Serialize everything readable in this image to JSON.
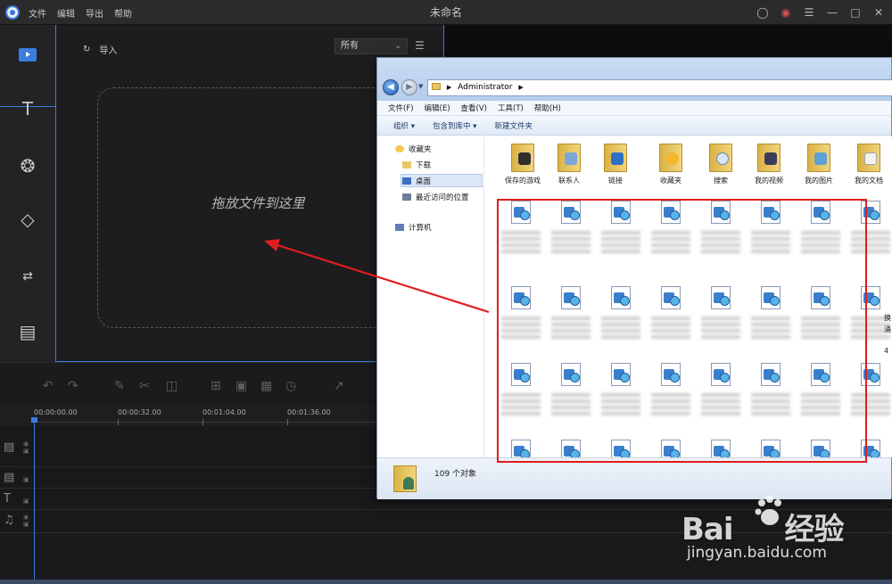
{
  "app": {
    "title": "未命名",
    "menu": [
      "文件",
      "编辑",
      "导出",
      "帮助"
    ],
    "titlebar_icons": [
      "user-icon",
      "message-icon",
      "menu-icon",
      "minimize-icon",
      "maximize-icon",
      "close-icon"
    ]
  },
  "media": {
    "import_label": "导入",
    "filter_value": "所有",
    "drop_hint": "拖放文件到这里"
  },
  "timeline": {
    "ticks": [
      "00:00:00.00",
      "00:00:32.00",
      "00:01:04.00",
      "00:01:36.00"
    ]
  },
  "explorer": {
    "address": [
      "Administrator"
    ],
    "menu": [
      "文件(F)",
      "编辑(E)",
      "查看(V)",
      "工具(T)",
      "帮助(H)"
    ],
    "commands": [
      "组织 ▾",
      "包含到库中 ▾",
      "新建文件夹"
    ],
    "nav": {
      "favorites": "收藏夹",
      "downloads": "下载",
      "desktop": "桌面",
      "recent": "最近访问的位置",
      "computer": "计算机"
    },
    "folders": [
      "保存的游戏",
      "联系人",
      "链接",
      "收藏夹",
      "搜索",
      "我的视频",
      "我的图片",
      "我的文档"
    ],
    "partial_text": [
      "换",
      "涌",
      "4"
    ],
    "status": "109 个对象"
  },
  "watermark": {
    "brand": "Bai",
    "brand_tail": "经验",
    "url": "jingyan.baidu.com"
  },
  "colors": {
    "accent": "#3b7ddd",
    "annotation": "#e11d1d"
  }
}
